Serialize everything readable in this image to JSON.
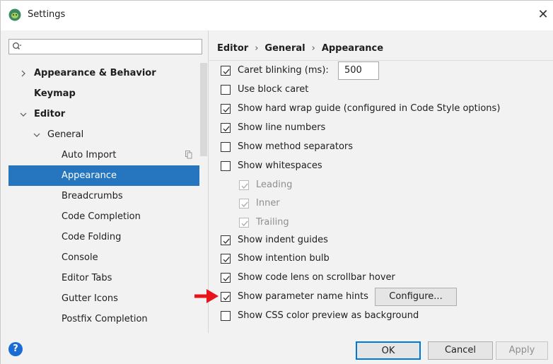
{
  "window": {
    "title": "Settings",
    "close_label": "✕"
  },
  "sidebar": {
    "search": {
      "value": "",
      "placeholder": ""
    },
    "items": [
      {
        "label": "Appearance & Behavior",
        "bold": true,
        "expanded": false
      },
      {
        "label": "Keymap",
        "bold": true
      },
      {
        "label": "Editor",
        "bold": true,
        "expanded": true
      },
      {
        "label": "General",
        "expanded": true
      },
      {
        "label": "Auto Import"
      },
      {
        "label": "Appearance",
        "selected": true
      },
      {
        "label": "Breadcrumbs"
      },
      {
        "label": "Code Completion"
      },
      {
        "label": "Code Folding"
      },
      {
        "label": "Console"
      },
      {
        "label": "Editor Tabs"
      },
      {
        "label": "Gutter Icons"
      },
      {
        "label": "Postfix Completion"
      }
    ]
  },
  "breadcrumb": [
    "Editor",
    "General",
    "Appearance"
  ],
  "options": [
    {
      "label": "Caret blinking (ms):",
      "checked": true,
      "value": "500"
    },
    {
      "label": "Use block caret",
      "checked": false
    },
    {
      "label": "Show hard wrap guide (configured in Code Style options)",
      "checked": true
    },
    {
      "label": "Show line numbers",
      "checked": true
    },
    {
      "label": "Show method separators",
      "checked": false
    },
    {
      "label": "Show whitespaces",
      "checked": false
    },
    {
      "label": "Leading",
      "checked": true,
      "disabled": true
    },
    {
      "label": "Inner",
      "checked": true,
      "disabled": true
    },
    {
      "label": "Trailing",
      "checked": true,
      "disabled": true
    },
    {
      "label": "Show indent guides",
      "checked": true
    },
    {
      "label": "Show intention bulb",
      "checked": true
    },
    {
      "label": "Show code lens on scrollbar hover",
      "checked": true
    },
    {
      "label": "Show parameter name hints",
      "checked": true,
      "button": "Configure..."
    },
    {
      "label": "Show CSS color preview as background",
      "checked": false
    }
  ],
  "footer": {
    "help": "?",
    "ok": "OK",
    "cancel": "Cancel",
    "apply": "Apply"
  },
  "colors": {
    "selection": "#2675bf",
    "annotation_arrow": "#e8141a",
    "help_icon": "#1a6bd4"
  }
}
